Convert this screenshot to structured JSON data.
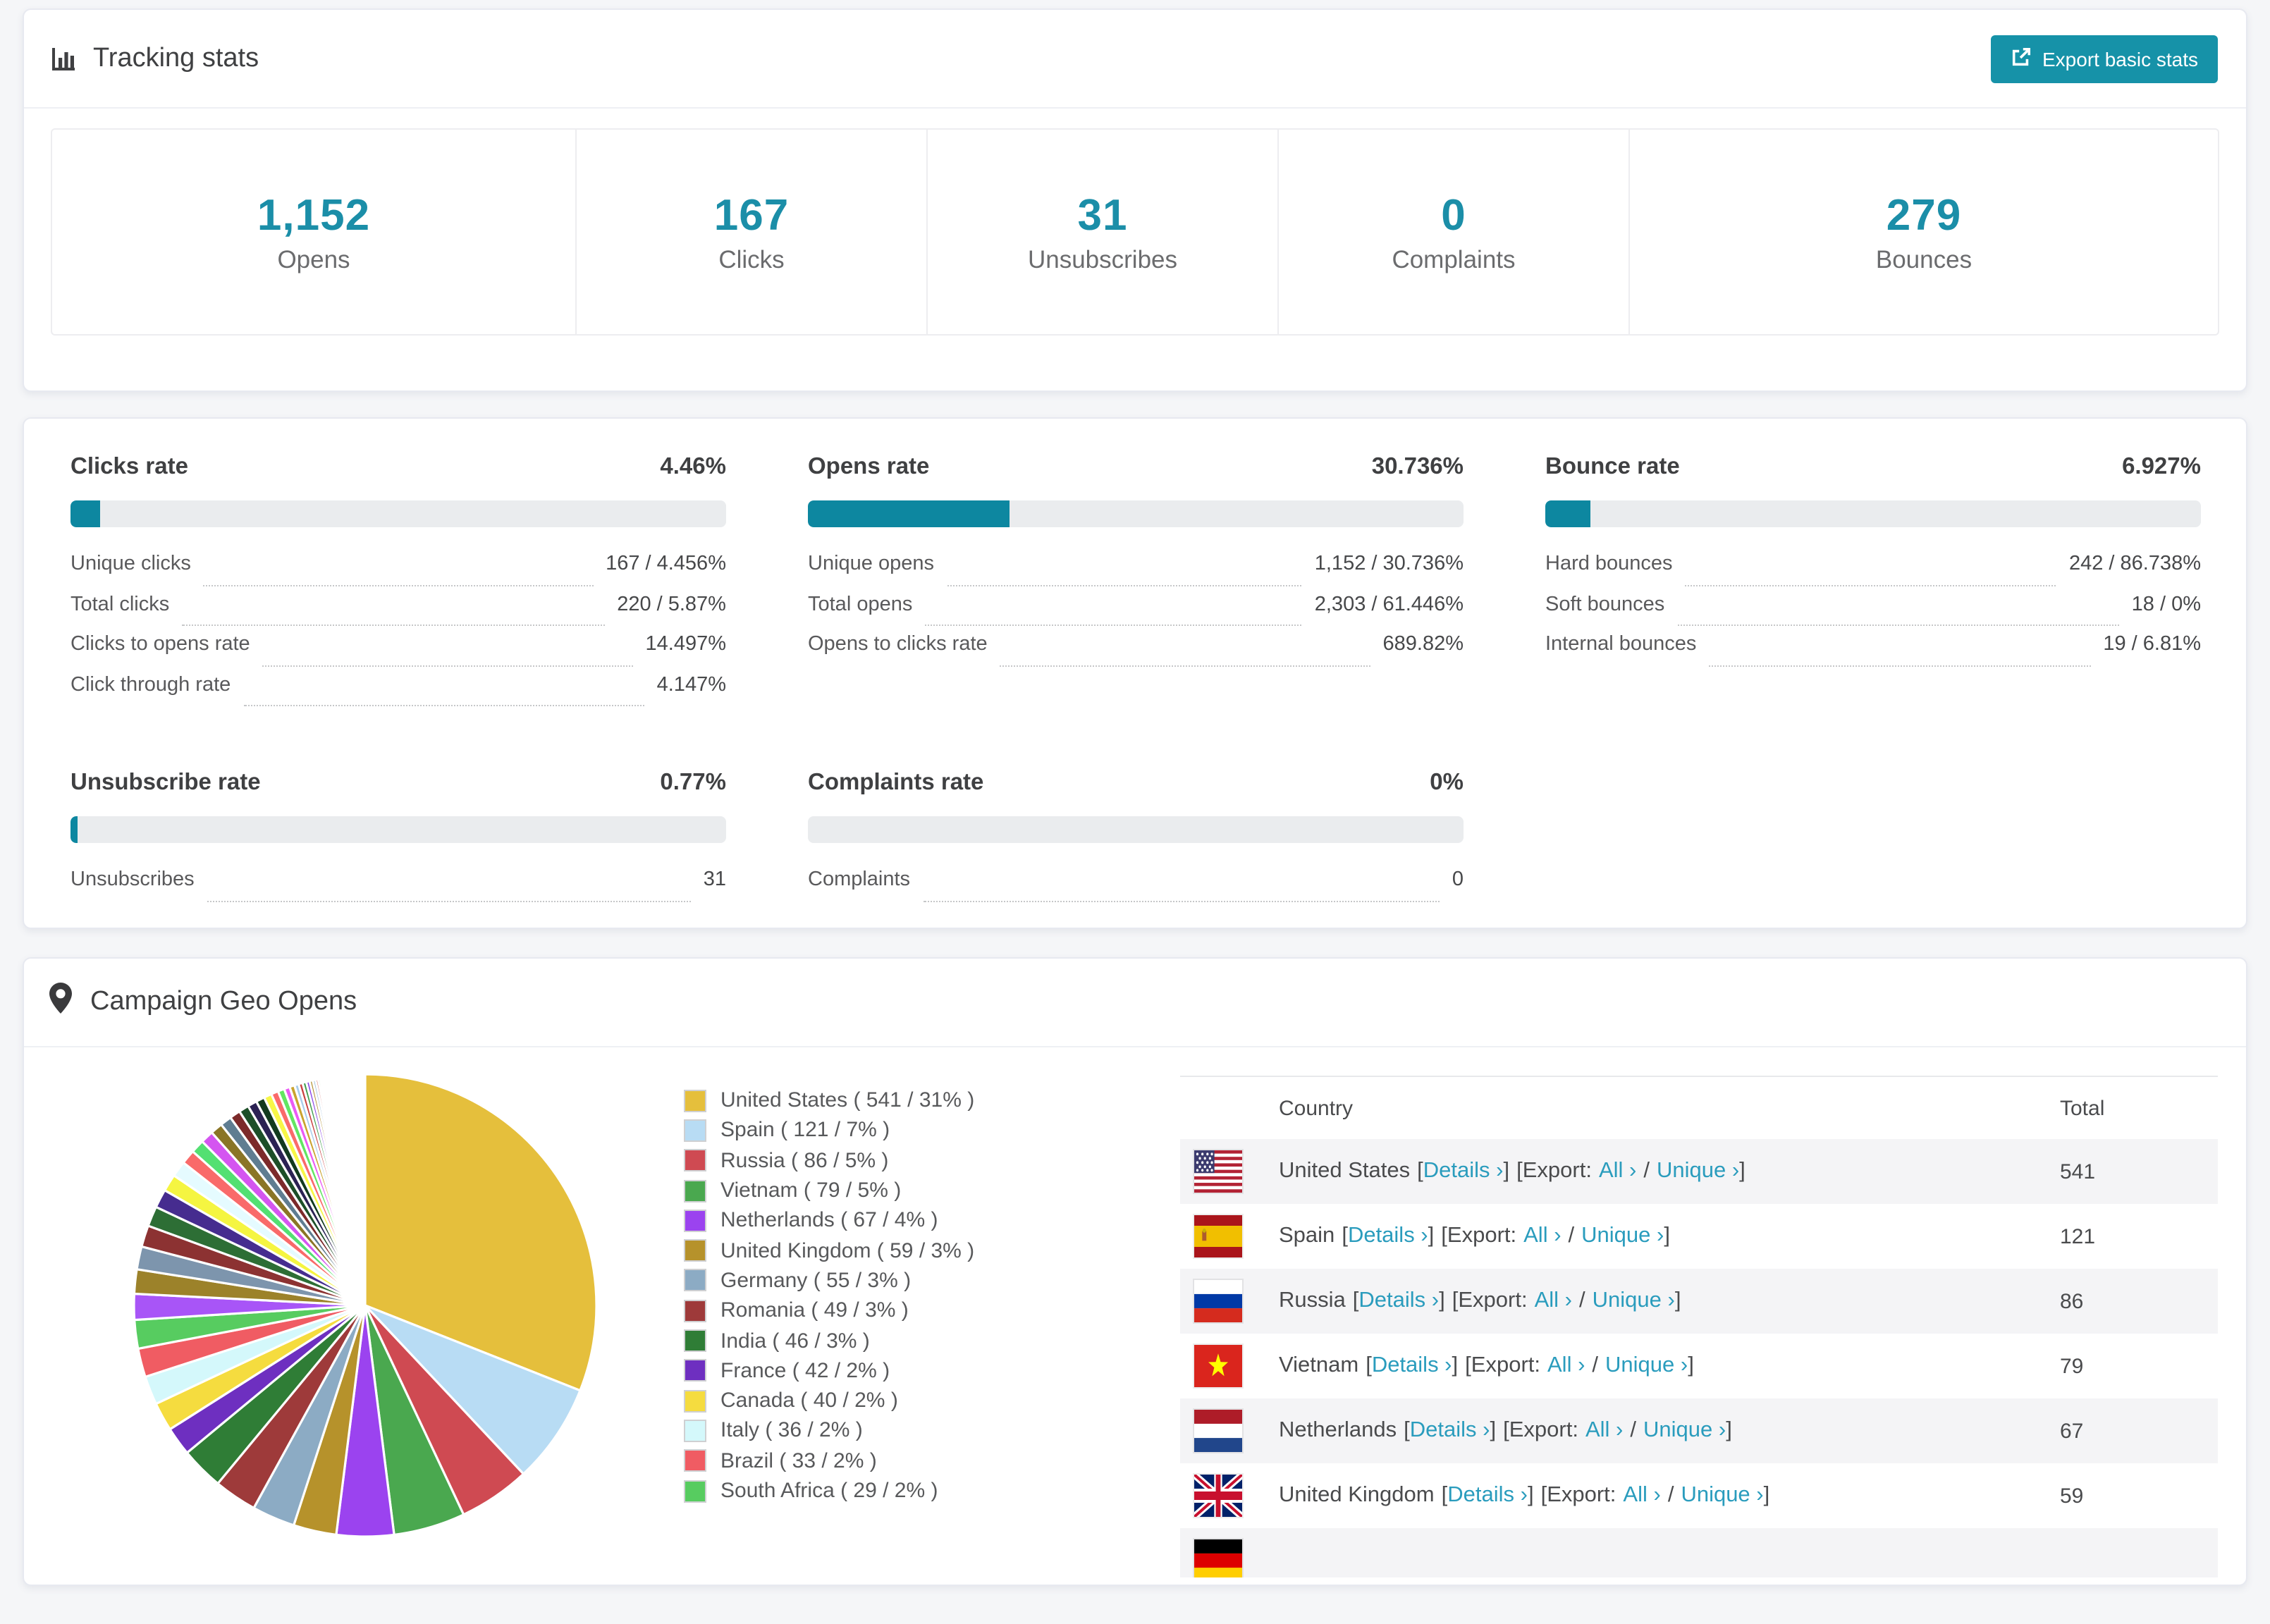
{
  "colors": {
    "accent": "#1b8ea8",
    "bar_fill": "#0d87a0",
    "button_bg": "#1692a8",
    "link": "#2a9cbd"
  },
  "tracking": {
    "title": "Tracking stats",
    "export_button": "Export basic stats",
    "stats": [
      {
        "value": "1,152",
        "label": "Opens"
      },
      {
        "value": "167",
        "label": "Clicks"
      },
      {
        "value": "31",
        "label": "Unsubscribes"
      },
      {
        "value": "0",
        "label": "Complaints"
      },
      {
        "value": "279",
        "label": "Bounces"
      }
    ]
  },
  "rates": {
    "blocks": [
      {
        "title": "Clicks rate",
        "value": "4.46%",
        "pct": 4.46,
        "rows": [
          {
            "label": "Unique clicks",
            "value": "167 / 4.456%"
          },
          {
            "label": "Total clicks",
            "value": "220 / 5.87%"
          },
          {
            "label": "Clicks to opens rate",
            "value": "14.497%"
          },
          {
            "label": "Click through rate",
            "value": "4.147%"
          }
        ]
      },
      {
        "title": "Opens rate",
        "value": "30.736%",
        "pct": 30.736,
        "rows": [
          {
            "label": "Unique opens",
            "value": "1,152 / 30.736%"
          },
          {
            "label": "Total opens",
            "value": "2,303 / 61.446%"
          },
          {
            "label": "Opens to clicks rate",
            "value": "689.82%"
          }
        ]
      },
      {
        "title": "Bounce rate",
        "value": "6.927%",
        "pct": 6.927,
        "rows": [
          {
            "label": "Hard bounces",
            "value": "242 / 86.738%"
          },
          {
            "label": "Soft bounces",
            "value": "18 / 0%"
          },
          {
            "label": "Internal bounces",
            "value": "19 / 6.81%"
          }
        ]
      },
      {
        "title": "Unsubscribe rate",
        "value": "0.77%",
        "pct": 0.77,
        "rows": [
          {
            "label": "Unsubscribes",
            "value": "31"
          }
        ]
      },
      {
        "title": "Complaints rate",
        "value": "0%",
        "pct": 0,
        "rows": [
          {
            "label": "Complaints",
            "value": "0"
          }
        ]
      }
    ]
  },
  "geo": {
    "title": "Campaign Geo Opens",
    "legend": [
      {
        "label": "United States ( 541 / 31% )",
        "color": "#e5bf3c"
      },
      {
        "label": "Spain ( 121 / 7% )",
        "color": "#b8dcf4"
      },
      {
        "label": "Russia ( 86 / 5% )",
        "color": "#cf4a52"
      },
      {
        "label": "Vietnam ( 79 / 5% )",
        "color": "#4aa84f"
      },
      {
        "label": "Netherlands ( 67 / 4% )",
        "color": "#9b43ef"
      },
      {
        "label": "United Kingdom ( 59 / 3% )",
        "color": "#b6922b"
      },
      {
        "label": "Germany ( 55 / 3% )",
        "color": "#8cabc4"
      },
      {
        "label": "Romania ( 49 / 3% )",
        "color": "#9e3a3a"
      },
      {
        "label": "India ( 46 / 3% )",
        "color": "#2f7d36"
      },
      {
        "label": "France ( 42 / 2% )",
        "color": "#6e2fc0"
      },
      {
        "label": "Canada ( 40 / 2% )",
        "color": "#f5dc3f"
      },
      {
        "label": "Italy ( 36 / 2% )",
        "color": "#d4f8fb"
      },
      {
        "label": "Brazil ( 33 / 2% )",
        "color": "#f05c63"
      },
      {
        "label": "South Africa ( 29 / 2% )",
        "color": "#57cc60"
      }
    ],
    "links": {
      "details": "Details ›",
      "export": "Export:",
      "all": "All ›",
      "unique": "Unique ›"
    },
    "punct": {
      "lb": "[",
      "rb": "]",
      "slash": "/"
    },
    "table": {
      "columns": {
        "country": "Country",
        "total": "Total"
      },
      "rows": [
        {
          "country": "United States",
          "total": "541"
        },
        {
          "country": "Spain",
          "total": "121"
        },
        {
          "country": "Russia",
          "total": "86"
        },
        {
          "country": "Vietnam",
          "total": "79"
        },
        {
          "country": "Netherlands",
          "total": "67"
        },
        {
          "country": "United Kingdom",
          "total": "59"
        },
        {
          "country": "",
          "total": ""
        }
      ]
    }
  },
  "chart_data": {
    "type": "pie",
    "title": "Campaign Geo Opens",
    "unit": "opens",
    "direction": "clockwise",
    "start_angle": "12 o'clock",
    "labels": [
      "United States",
      "Spain",
      "Russia",
      "Vietnam",
      "Netherlands",
      "United Kingdom",
      "Germany",
      "Romania",
      "India",
      "France",
      "Canada",
      "Italy",
      "Brazil",
      "South Africa"
    ],
    "values": [
      541,
      121,
      86,
      79,
      67,
      59,
      55,
      49,
      46,
      42,
      40,
      36,
      33,
      29
    ],
    "pcts": [
      31,
      7,
      5,
      5,
      4,
      3,
      3,
      3,
      3,
      2,
      2,
      2,
      2,
      2
    ],
    "colors": [
      "#e5bf3c",
      "#b8dcf4",
      "#cf4a52",
      "#4aa84f",
      "#9b43ef",
      "#b6922b",
      "#8cabc4",
      "#9e3a3a",
      "#2f7d36",
      "#6e2fc0",
      "#f5dc3f",
      "#d4f8fb",
      "#f05c63",
      "#57cc60"
    ],
    "unlabeled_tail": {
      "pcts": [
        1.8,
        1.7,
        1.6,
        1.5,
        1.4,
        1.3,
        1.2,
        1.1,
        1.0,
        0.95,
        0.9,
        0.85,
        0.8,
        0.75,
        0.7,
        0.65,
        0.6,
        0.55,
        0.5,
        0.45,
        0.4,
        0.35,
        0.3,
        0.28,
        0.26,
        0.24,
        0.22,
        0.2,
        0.18,
        0.16,
        0.14,
        0.12,
        0.11,
        0.1,
        0.09,
        0.08,
        0.07,
        0.06,
        0.05,
        0.05
      ],
      "colors": [
        "#a855f7",
        "#9c822a",
        "#7d95ad",
        "#8c3232",
        "#2d6e35",
        "#462c8f",
        "#f5f541",
        "#e5fbff",
        "#f96a6a",
        "#53e072",
        "#d455f0",
        "#8a7526",
        "#5f7d91",
        "#7c2a2a",
        "#1d4f28",
        "#2b2253",
        "#123a1e",
        "#f7f747",
        "#fa6a6a",
        "#62e662",
        "#ea5af5",
        "#caa32e",
        "#a8cdeb",
        "#c94040",
        "#3f9e4d",
        "#8a46e8",
        "#b08d2b",
        "#93b8d8",
        "#d14b4b",
        "#4caf50",
        "#9750eb",
        "#c8a032",
        "#e57373",
        "#66bb6a",
        "#b55cf5",
        "#8591a0",
        "#e84a4a",
        "#2e8b3a",
        "#6a5acd",
        "#d4af37"
      ]
    }
  }
}
